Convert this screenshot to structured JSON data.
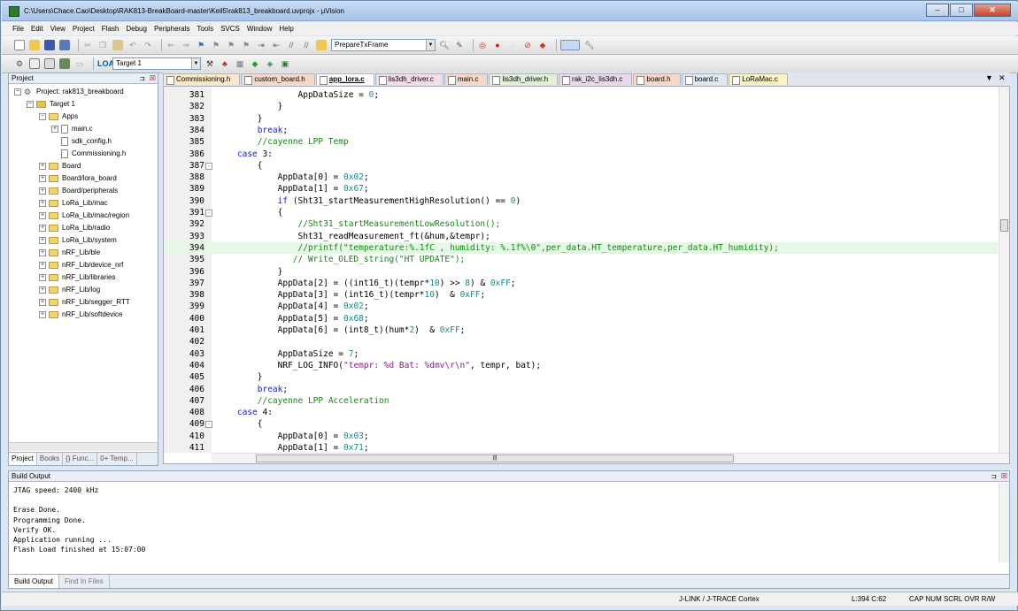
{
  "window": {
    "title": "C:\\Users\\Chace.Cao\\Desktop\\RAK813-BreakBoard-master\\Keil5\\rak813_breakboard.uvprojx - µVision"
  },
  "menu": [
    "File",
    "Edit",
    "View",
    "Project",
    "Flash",
    "Debug",
    "Peripherals",
    "Tools",
    "SVCS",
    "Window",
    "Help"
  ],
  "toolbar": {
    "find_combo": "PrepareTxFrame",
    "target_combo": "Target 1"
  },
  "project": {
    "header": "Project",
    "root": "Project: rak813_breakboard",
    "target": "Target 1",
    "apps": "Apps",
    "files": [
      "main.c",
      "sdk_config.h",
      "Commissioning.h"
    ],
    "groups": [
      "Board",
      "Board/lora_board",
      "Board/peripherals",
      "LoRa_Lib/mac",
      "LoRa_Lib/mac/region",
      "LoRa_Lib/radio",
      "LoRa_Lib/system",
      "nRF_Lib/ble",
      "nRF_Lib/device_nrf",
      "nRF_Lib/libraries",
      "nRF_Lib/log",
      "nRF_Lib/segger_RTT",
      "nRF_Lib/softdevice"
    ],
    "tabs": [
      "Project",
      "Books",
      "{} Func...",
      "0+ Temp..."
    ]
  },
  "editor_tabs": [
    {
      "label": "Commissioning.h",
      "color": "#fbe9c8"
    },
    {
      "label": "custom_board.h",
      "color": "#f5d8c8"
    },
    {
      "label": "app_lora.c",
      "color": "#ffffff"
    },
    {
      "label": "lis3dh_driver.c",
      "color": "#f2dce8"
    },
    {
      "label": "main.c",
      "color": "#f5d8c8"
    },
    {
      "label": "lis3dh_driver.h",
      "color": "#e2f0d8"
    },
    {
      "label": "rak_i2c_lis3dh.c",
      "color": "#e8d8ec"
    },
    {
      "label": "board.h",
      "color": "#f5d8c8"
    },
    {
      "label": "board.c",
      "color": "#dfe8f0"
    },
    {
      "label": "LoRaMac.c",
      "color": "#fbf3c8"
    }
  ],
  "code": [
    {
      "n": "381",
      "f": "",
      "t": "                AppDataSize = 0;"
    },
    {
      "n": "382",
      "f": "",
      "t": "            }"
    },
    {
      "n": "383",
      "f": "",
      "t": "        }"
    },
    {
      "n": "384",
      "f": "",
      "t": "        break;"
    },
    {
      "n": "385",
      "f": "",
      "t": "        //cayenne LPP Temp"
    },
    {
      "n": "386",
      "f": "",
      "t": "    case 3:"
    },
    {
      "n": "387",
      "f": "-",
      "t": "        {"
    },
    {
      "n": "388",
      "f": "",
      "t": "            AppData[0] = 0x02;"
    },
    {
      "n": "389",
      "f": "",
      "t": "            AppData[1] = 0x67;"
    },
    {
      "n": "390",
      "f": "",
      "t": "            if (Sht31_startMeasurementHighResolution() == 0)"
    },
    {
      "n": "391",
      "f": "-",
      "t": "            {"
    },
    {
      "n": "392",
      "f": "",
      "t": "                //Sht31_startMeasurementLowResolution();"
    },
    {
      "n": "393",
      "f": "",
      "t": "                Sht31_readMeasurement_ft(&hum,&tempr);"
    },
    {
      "n": "394",
      "f": "",
      "t": "                //printf(\"temperature:%.1fC , humidity: %.1f%\\0\",per_data.HT_temperature,per_data.HT_humidity);"
    },
    {
      "n": "395",
      "f": "",
      "t": "               // Write_OLED_string(\"HT UPDATE\");"
    },
    {
      "n": "396",
      "f": "",
      "t": "            }"
    },
    {
      "n": "397",
      "f": "",
      "t": "            AppData[2] = ((int16_t)(tempr*10) >> 8) & 0xFF;"
    },
    {
      "n": "398",
      "f": "",
      "t": "            AppData[3] = (int16_t)(tempr*10)  & 0xFF;"
    },
    {
      "n": "399",
      "f": "",
      "t": "            AppData[4] = 0x02;"
    },
    {
      "n": "400",
      "f": "",
      "t": "            AppData[5] = 0x68;"
    },
    {
      "n": "401",
      "f": "",
      "t": "            AppData[6] = (int8_t)(hum*2)  & 0xFF;"
    },
    {
      "n": "402",
      "f": "",
      "t": ""
    },
    {
      "n": "403",
      "f": "",
      "t": "            AppDataSize = 7;"
    },
    {
      "n": "404",
      "f": "",
      "t": "            NRF_LOG_INFO(\"tempr: %d Bat: %dmv\\r\\n\", tempr, bat);"
    },
    {
      "n": "405",
      "f": "",
      "t": "        }"
    },
    {
      "n": "406",
      "f": "",
      "t": "        break;"
    },
    {
      "n": "407",
      "f": "",
      "t": "        //cayenne LPP Acceleration"
    },
    {
      "n": "408",
      "f": "",
      "t": "    case 4:"
    },
    {
      "n": "409",
      "f": "-",
      "t": "        {"
    },
    {
      "n": "410",
      "f": "",
      "t": "            AppData[0] = 0x03;"
    },
    {
      "n": "411",
      "f": "",
      "t": "            AppData[1] = 0x71;"
    }
  ],
  "highlight_line": "394",
  "build": {
    "header": "Build Output",
    "text": "JTAG speed: 2400 kHz\n\nErase Done.\nProgramming Done.\nVerify OK.\nApplication running ...\nFlash Load finished at 15:07:00",
    "tabs": [
      "Build Output",
      "Find In Files"
    ]
  },
  "status": {
    "debugger": "J-LINK / J-TRACE Cortex",
    "position": "L:394 C:62",
    "keys": "CAP  NUM  SCRL  OVR  R/W"
  },
  "colors": {
    "keyword": "#1a1adc",
    "comment": "#118a11",
    "string": "#8a1a8a",
    "number": "#1a8a8a",
    "highlight": "#e6f7e6"
  }
}
